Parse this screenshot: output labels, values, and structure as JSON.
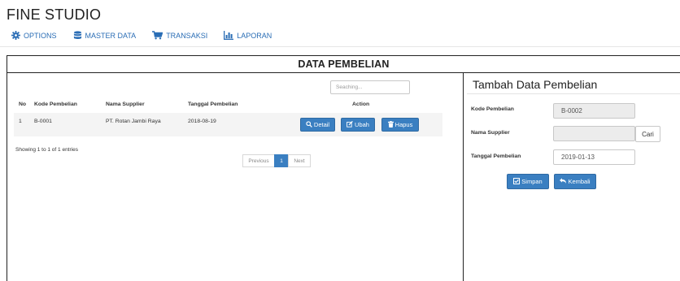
{
  "app": {
    "title": "FINE STUDIO"
  },
  "nav": {
    "items": [
      {
        "label": "OPTIONS",
        "icon": "gear-icon"
      },
      {
        "label": "MASTER DATA",
        "icon": "database-icon"
      },
      {
        "label": "TRANSAKSI",
        "icon": "cart-icon"
      },
      {
        "label": "LAPORAN",
        "icon": "bar-chart-icon"
      }
    ]
  },
  "colors": {
    "accent": "#3a7fc1",
    "link": "#2a6db5",
    "border": "#222222",
    "row_bg": "#f4f4f4"
  },
  "main": {
    "title": "DATA PEMBELIAN",
    "search": {
      "placeholder": "Seaching...",
      "value": ""
    },
    "table": {
      "headers": [
        "No",
        "Kode Pembelian",
        "Nama Supplier",
        "Tanggal Pembelian",
        "Action"
      ],
      "rows": [
        {
          "no": "1",
          "kode": "B-0001",
          "supplier": "PT. Rotan Jambi Raya",
          "tanggal": "2018-08-19"
        }
      ],
      "actions": {
        "detail": "Detail",
        "ubah": "Ubah",
        "hapus": "Hapus"
      }
    },
    "info": "Showing 1 to 1 of 1 entries",
    "pagination": {
      "previous": "Previous",
      "current": "1",
      "next": "Next"
    }
  },
  "form": {
    "title": "Tambah Data Pembelian",
    "kode_label": "Kode Pembelian",
    "kode_value": "B-0002",
    "supplier_label": "Nama Supplier",
    "supplier_value": "",
    "cari_label": "Cari",
    "tanggal_label": "Tanggal Pembelian",
    "tanggal_value": "2019-01-13",
    "simpan_label": "Simpan",
    "kembali_label": "Kembali"
  }
}
